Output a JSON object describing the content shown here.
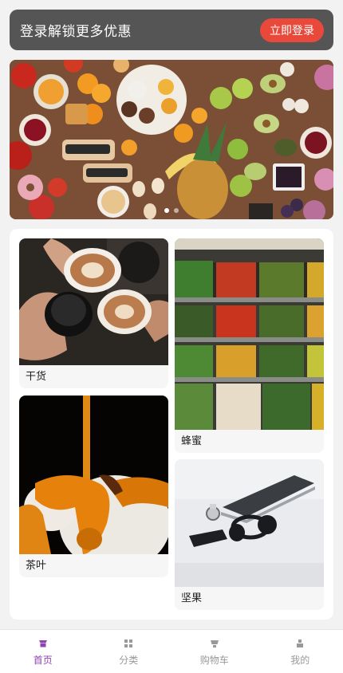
{
  "login_bar": {
    "text": "登录解锁更多优惠",
    "button_label": "立即登录"
  },
  "banner": {
    "slide_count": 2,
    "active_slide": 1
  },
  "categories": [
    {
      "label": "干货"
    },
    {
      "label": "蜂蜜"
    },
    {
      "label": "茶叶"
    },
    {
      "label": "坚果"
    }
  ],
  "tabbar": {
    "items": [
      {
        "label": "首页",
        "icon": "home-icon",
        "active": true
      },
      {
        "label": "分类",
        "icon": "category-icon",
        "active": false
      },
      {
        "label": "购物车",
        "icon": "cart-icon",
        "active": false
      },
      {
        "label": "我的",
        "icon": "user-icon",
        "active": false
      }
    ]
  },
  "colors": {
    "accent": "#8e44ad",
    "login_button": "#e8493a",
    "login_bar": "#555556"
  }
}
